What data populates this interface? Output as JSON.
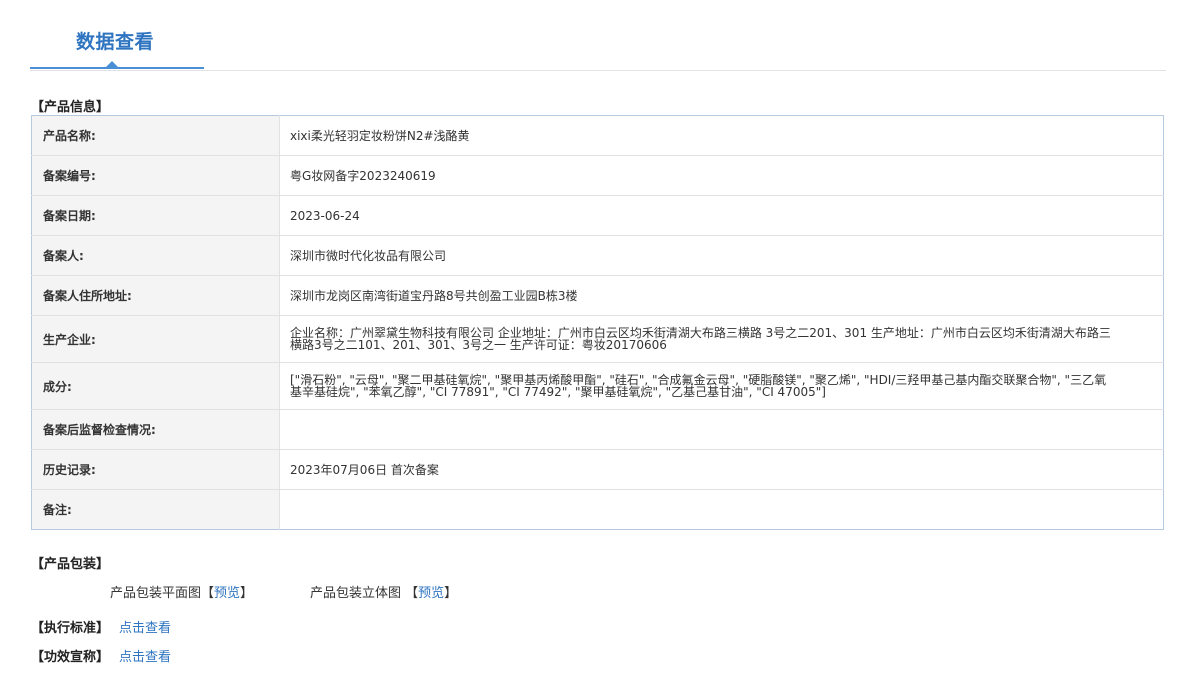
{
  "tab": {
    "label": "数据查看"
  },
  "product_info": {
    "title": "【产品信息】",
    "rows": [
      {
        "label": "产品名称:",
        "value": "xixi柔光轻羽定妆粉饼N2#浅酪黄"
      },
      {
        "label": "备案编号:",
        "value": "粤G妆网备字2023240619"
      },
      {
        "label": "备案日期:",
        "value": "2023-06-24"
      },
      {
        "label": "备案人:",
        "value": "深圳市微时代化妆品有限公司"
      },
      {
        "label": "备案人住所地址:",
        "value": "深圳市龙岗区南湾街道宝丹路8号共创盈工业园B栋3楼"
      },
      {
        "label": "生产企业:",
        "value": "企业名称：广州翠黛生物科技有限公司 企业地址：广州市白云区均禾街清湖大布路三横路 3号之二201、301 生产地址：广州市白云区均禾街清湖大布路三横路3号之二101、201、301、3号之一 生产许可证：粤妆20170606"
      },
      {
        "label": "成分:",
        "value": "[\"滑石粉\", \"云母\", \"聚二甲基硅氧烷\", \"聚甲基丙烯酸甲酯\", \"硅石\", \"合成氟金云母\", \"硬脂酸镁\", \"聚乙烯\", \"HDI/三羟甲基己基内酯交联聚合物\", \"三乙氧基辛基硅烷\", \"苯氧乙醇\", \"CI 77891\", \"CI 77492\", \"聚甲基硅氧烷\", \"乙基己基甘油\", \"CI 47005\"]"
      },
      {
        "label": "备案后监督检查情况:",
        "value": ""
      },
      {
        "label": "历史记录:",
        "value": "2023年07月06日 首次备案"
      },
      {
        "label": "备注:",
        "value": ""
      }
    ]
  },
  "packaging": {
    "title": "【产品包装】",
    "flat_label": "产品包装平面图【",
    "flat_link": "预览",
    "flat_close": "】",
    "solid_label": "产品包装立体图 【",
    "solid_link": "预览",
    "solid_close": "】"
  },
  "standard": {
    "title": "【执行标准】",
    "link": "点击查看"
  },
  "efficacy": {
    "title": "【功效宣称】",
    "link": "点击查看"
  }
}
